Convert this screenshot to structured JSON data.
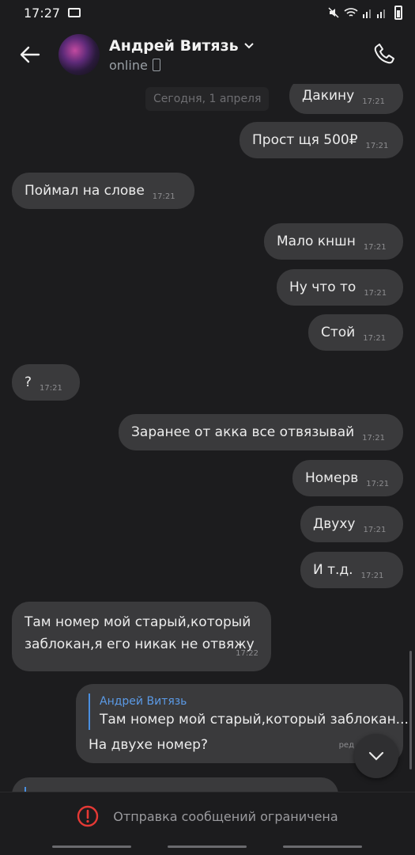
{
  "status": {
    "time": "17:27",
    "signal_text": "Vo) LTE ..l ..l"
  },
  "header": {
    "name": "Андрей Витязь",
    "status": "online"
  },
  "chat": {
    "date": "Сегодня, 1 апреля",
    "messages": [
      {
        "text": "Дакину",
        "time": "17:21",
        "side": "out"
      },
      {
        "text": "Прост щя 500₽",
        "time": "17:21",
        "side": "out"
      },
      {
        "text": "Поймал на слове",
        "time": "17:21",
        "side": "in"
      },
      {
        "text": "Мало кншн",
        "time": "17:21",
        "side": "out"
      },
      {
        "text": "Ну что то",
        "time": "17:21",
        "side": "out"
      },
      {
        "text": "Стой",
        "time": "17:21",
        "side": "out"
      },
      {
        "text": "?",
        "time": "17:21",
        "side": "in"
      },
      {
        "text": "Заранее от акка все отвязывай",
        "time": "17:21",
        "side": "out"
      },
      {
        "text": "Номерв",
        "time": "17:21",
        "side": "out"
      },
      {
        "text": "Двуху",
        "time": "17:21",
        "side": "out"
      },
      {
        "text": "И т.д.",
        "time": "17:21",
        "side": "out"
      }
    ],
    "long_message": {
      "line1": "Там номер мой старый,который",
      "line2": "заблокан,я его никак не отвяжу",
      "time": "17:22"
    },
    "reply_message": {
      "quote_name": "Андрей Витязь",
      "quote_text": "Там номер мой старый,который заблокан...",
      "text": "На двухе номер?",
      "time": "ред"
    }
  },
  "footer": {
    "text": "Отправка сообщений ограничена"
  },
  "colors": {
    "bubble": "#3a3a3c",
    "background": "#1c1c1e",
    "accent": "#5b9ae6",
    "warning": "#e53935"
  }
}
